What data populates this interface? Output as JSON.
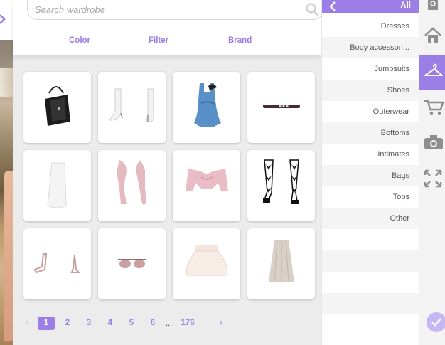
{
  "search": {
    "placeholder": "Search wardrobe"
  },
  "filters": [
    "Color",
    "Filter",
    "Brand"
  ],
  "items": [
    {
      "name": "black-handbag-item"
    },
    {
      "name": "white-lace-boots-item"
    },
    {
      "name": "blue-dress-item"
    },
    {
      "name": "black-choker-item"
    },
    {
      "name": "white-skirt-item"
    },
    {
      "name": "pink-sleeves-item"
    },
    {
      "name": "pink-crop-top-item"
    },
    {
      "name": "heart-stockings-item"
    },
    {
      "name": "pink-sandals-item"
    },
    {
      "name": "sunglasses-item"
    },
    {
      "name": "cream-tutu-skirt-item"
    },
    {
      "name": "pleated-skirt-item"
    }
  ],
  "pagination": {
    "pages": [
      "1",
      "2",
      "3",
      "4",
      "5",
      "6"
    ],
    "ellipsis": "...",
    "last": "176",
    "current": "1"
  },
  "categories": {
    "header": "All",
    "items": [
      "Dresses",
      "Body accessori...",
      "Jumpsuits",
      "Shoes",
      "Outerwear",
      "Bottoms",
      "Intimates",
      "Bags",
      "Tops",
      "Other"
    ]
  },
  "toolbar": {
    "buttons": [
      "home-icon",
      "hanger-icon",
      "shopping-cart-icon",
      "camera-icon",
      "expand-icon"
    ],
    "active": "hanger-icon"
  },
  "colors": {
    "accent": "#9b7fe6",
    "accent_light": "#c6b6f3"
  }
}
